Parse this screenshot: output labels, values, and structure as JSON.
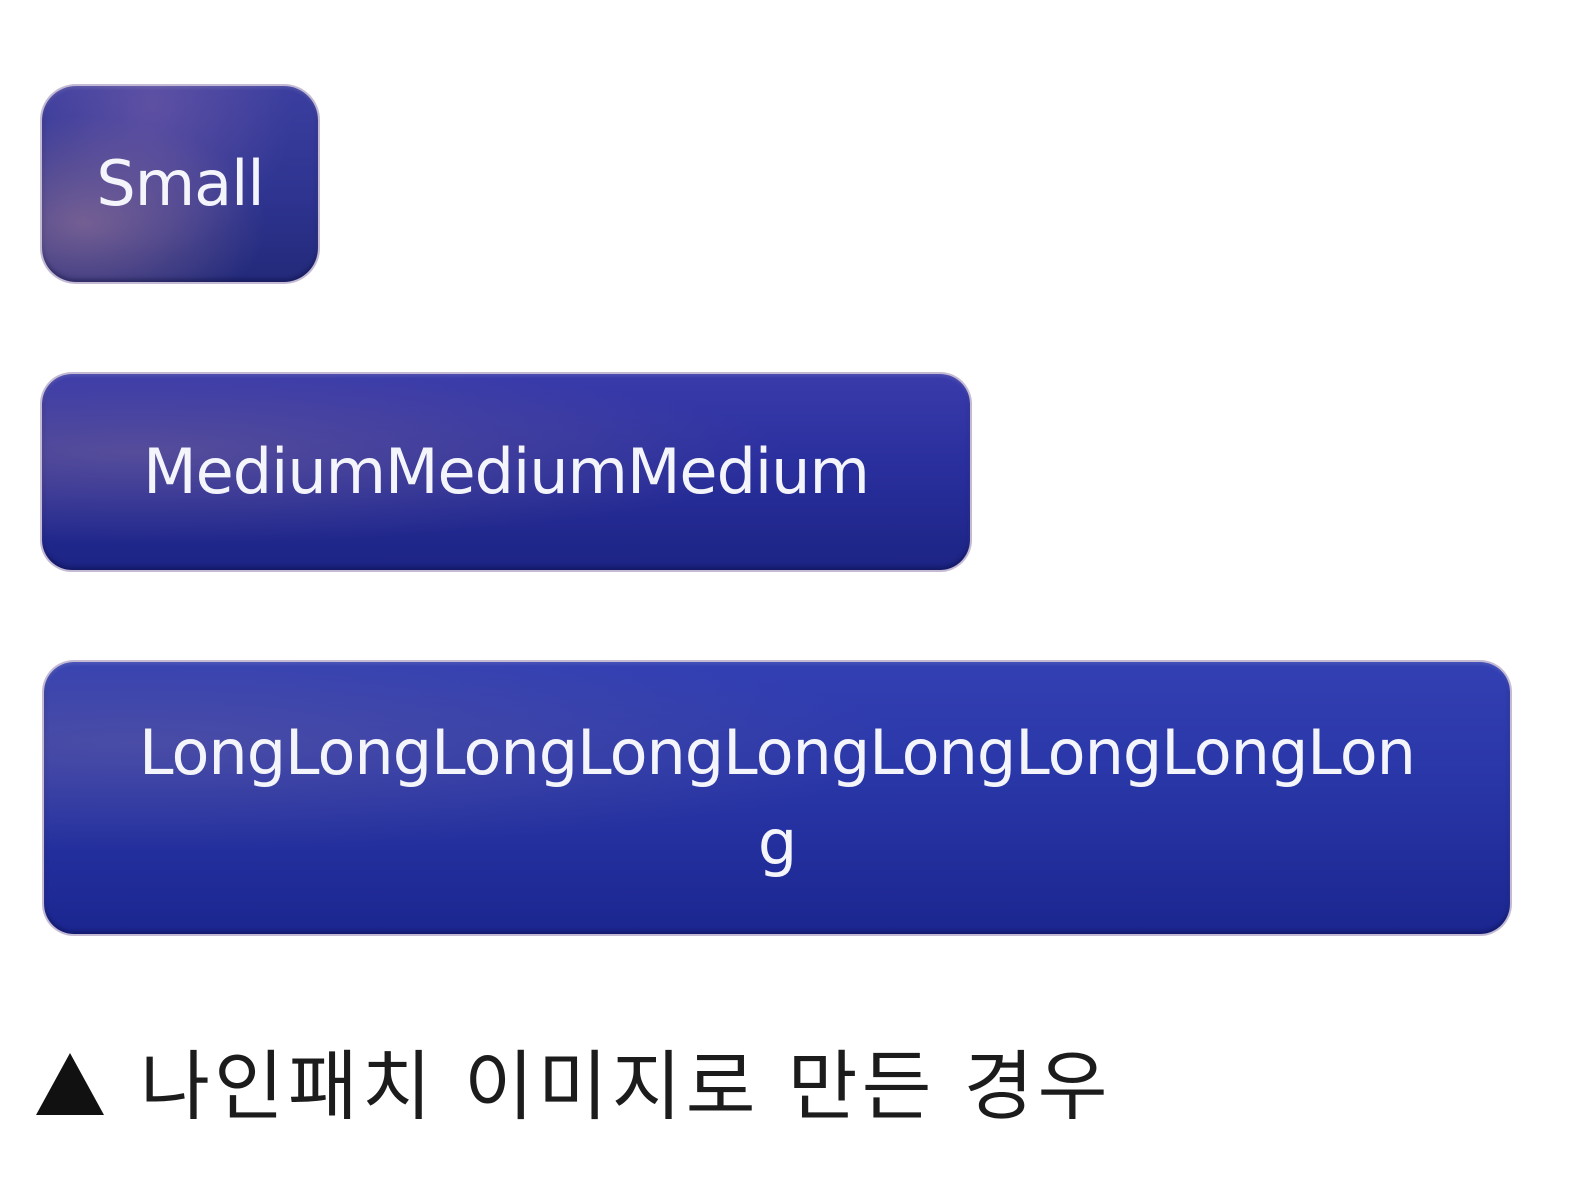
{
  "buttons": {
    "small": {
      "label": "Small"
    },
    "medium": {
      "label": "MediumMediumMedium"
    },
    "long": {
      "label": "LongLongLongLongLongLongLongLongLong"
    }
  },
  "caption": {
    "icon": "black-up-triangle",
    "text": "나인패치 이미지로 만든 경우"
  },
  "colors": {
    "button_fill": "#2a2f9e",
    "button_text": "#f4f4fb",
    "caption_text": "#1c1c1c",
    "background": "#ffffff"
  }
}
